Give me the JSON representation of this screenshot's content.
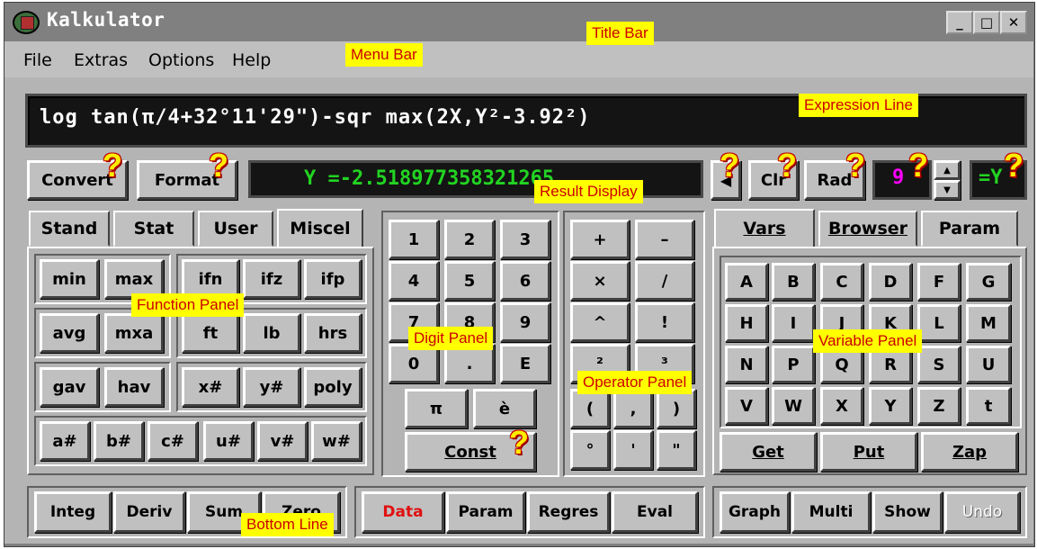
{
  "window": {
    "title": "Kalkulator",
    "controls": {
      "minimize": "_",
      "maximize": "□",
      "close": "✕"
    }
  },
  "menu": [
    "File",
    "Extras",
    "Options",
    "Help"
  ],
  "expression": "log tan(π/4+32°11'29\")-sqr max(2X,Y²-3.92²)",
  "toolbar": {
    "convert": "Convert",
    "format": "Format",
    "result": "Y =-2.518977358321265",
    "back": "◀",
    "clr": "Clr",
    "rad": "Rad",
    "digits": "9",
    "assign": "=Y"
  },
  "function_tabs": [
    "Stand",
    "Stat",
    "User",
    "Miscel"
  ],
  "function_buttons": [
    [
      "min",
      "max",
      "ifn",
      "ifz",
      "ifp"
    ],
    [
      "avg",
      "mxa",
      "ft",
      "lb",
      "hrs"
    ],
    [
      "gav",
      "hav",
      "x#",
      "y#",
      "poly"
    ],
    [
      "a#",
      "b#",
      "c#",
      "u#",
      "v#",
      "w#"
    ]
  ],
  "digits": [
    [
      "1",
      "2",
      "3"
    ],
    [
      "4",
      "5",
      "6"
    ],
    [
      "7",
      "8",
      "9"
    ],
    [
      "0",
      ".",
      "E"
    ]
  ],
  "digit_extra": {
    "pi": "π",
    "e": "è",
    "const": "Const"
  },
  "operators": [
    [
      "+",
      "–"
    ],
    [
      "×",
      "/"
    ],
    [
      "^",
      "!"
    ],
    [
      "²",
      "³"
    ],
    [
      "(",
      ",",
      ")"
    ],
    [
      "°",
      "'",
      "\""
    ]
  ],
  "variable_tabs": [
    "Vars",
    "Browser",
    "Param"
  ],
  "variables": [
    [
      "A",
      "B",
      "C",
      "D",
      "F",
      "G"
    ],
    [
      "H",
      "I",
      "J",
      "K",
      "L",
      "M"
    ],
    [
      "N",
      "P",
      "Q",
      "R",
      "S",
      "U"
    ],
    [
      "V",
      "W",
      "X",
      "Y",
      "Z",
      "t"
    ]
  ],
  "variable_actions": [
    "Get",
    "Put",
    "Zap"
  ],
  "bottom": {
    "group1": [
      "Integ",
      "Deriv",
      "Sum",
      "Zero"
    ],
    "group2": [
      "Data",
      "Param",
      "Regres",
      "Eval"
    ],
    "group3": [
      "Graph",
      "Multi",
      "Show",
      "Undo"
    ]
  },
  "colors": {
    "data_active": "#e01010",
    "result_text": "#22d422",
    "digits_value": "#ff00ff",
    "assign_text": "#22d422"
  },
  "annotations": {
    "title_bar": "Title Bar",
    "menu_bar": "Menu Bar",
    "expression_line": "Expression Line",
    "result_display": "Result Display",
    "function_panel": "Function Panel",
    "digit_panel": "Digit Panel",
    "operator_panel": "Operator Panel",
    "variable_panel": "Variable Panel",
    "bottom_line": "Bottom Line",
    "help_marker": "?"
  }
}
